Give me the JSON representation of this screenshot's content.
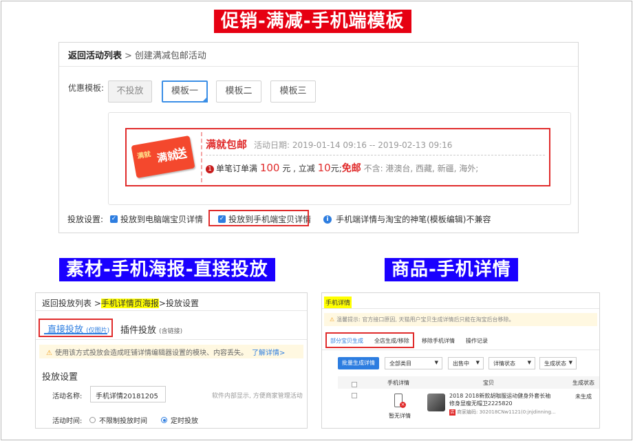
{
  "banners": {
    "top": "促销-满减-手机端模板",
    "left": "素材-手机海报-直接投放",
    "right": "商品-手机详情"
  },
  "panel1": {
    "breadcrumb_back": "返回活动列表",
    "breadcrumb_sep": ">",
    "breadcrumb_current": "创建满减包邮活动",
    "template_label": "优惠模板:",
    "template_buttons": [
      "不投放",
      "模板一",
      "模板二",
      "模板三"
    ],
    "promo": {
      "tag_small": "满就",
      "tag_mid": "满就",
      "tag_big": "送",
      "title": "满就包邮",
      "date": "活动日期: 2019-01-14 09:16 -- 2019-02-13 09:16",
      "rule_num": "1",
      "rule_prefix": "单笔订单满",
      "rule_amount": "100",
      "rule_yuan1": "元 , 立减",
      "rule_discount": "10",
      "rule_yuan2": "元;",
      "rule_free": "免邮",
      "rule_exclude": "不含: 港澳台, 西藏, 新疆, 海外;"
    },
    "settings_label": "投放设置:",
    "option_pc": "投放到电脑端宝贝详情",
    "option_mobile": "投放到手机端宝贝详情",
    "info_text": "手机端详情与淘宝的神笔(模板编辑)不兼容",
    "check": "✓",
    "info_icon": "i"
  },
  "panel2": {
    "bc_back": "返回投放列表",
    "bc_sep1": ">",
    "bc_mid": "手机详情页海报",
    "bc_sep2": ">",
    "bc_end": "投放设置",
    "tab_direct": "直接投放",
    "tab_direct_note": "(仅图片)",
    "tab_plugin": "插件投放",
    "tab_plugin_note": "(含链接)",
    "warning": "使用该方式投放会造成旺铺详情编辑器设置的模块、内容丢失。",
    "warning_link": "了解详情>",
    "section_title": "投放设置",
    "name_label": "活动名称:",
    "name_value": "手机详情20181205",
    "name_hint": "软件内部显示, 方便商家管理活动",
    "time_label": "活动时间:",
    "time_opt1": "不限制投放时间",
    "time_opt2": "定时投放"
  },
  "panel3": {
    "title": "手机详情",
    "warning": "温馨提示: 官方接口原因, 天猫用户宝贝生成详情后只能在淘宝后台移除。",
    "tabs": [
      "部分宝贝生成",
      "全店生成/移除",
      "移除手机详情",
      "操作记录"
    ],
    "btn_batch": "批量生成详情",
    "filters": [
      "全部类目",
      "出售中",
      "详情状态",
      "生成状态"
    ],
    "columns": [
      "手机详情",
      "宝贝",
      "生成状态"
    ],
    "row": {
      "detail_text": "暂无详情",
      "product_name": "2018 2018新款胡咖服运动健身外套长袖修身显瘦无帽卫2225820",
      "product_code_badge": "店",
      "product_code": "商家编码: 302018CNw1121(0:jnjdinning...",
      "status": "未生成"
    },
    "arrow": "▼",
    "x": "×"
  }
}
